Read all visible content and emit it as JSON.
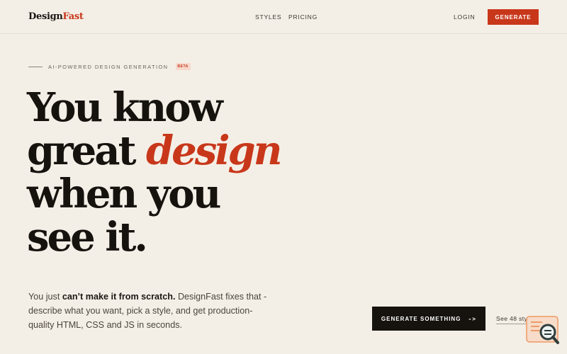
{
  "nav": {
    "logo_main": "Design",
    "logo_accent": "Fast",
    "links": [
      "STYLES",
      "PRICING"
    ],
    "login": "LOGIN",
    "generate": "GENERATE"
  },
  "hero": {
    "eyebrow": "AI-POWERED DESIGN GENERATION",
    "badge": "BETA",
    "headline_line1": "You know",
    "headline_line2_a": "great",
    "headline_line2_b": "design",
    "headline_line3": "when you",
    "headline_line4": "see it.",
    "lead_a": "You just ",
    "lead_strong": "can’t make it from scratch.",
    "lead_b": " DesignFast fixes that - describe what you want, pick a style, and get production-quality HTML, CSS and JS in seconds.",
    "cta_primary": "GENERATE SOMETHING",
    "cta_arrow": "->",
    "cta_secondary": "See 48 styles"
  },
  "colors": {
    "background": "#f4efe6",
    "accent": "#c8371a",
    "ink": "#16130f"
  },
  "widget": {
    "icon": "search-chat-icon"
  }
}
